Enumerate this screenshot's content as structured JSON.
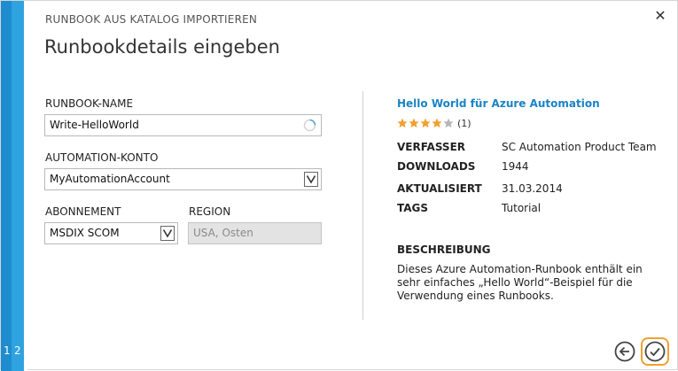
{
  "wizard": {
    "subtitle": "RUNBOOK AUS KATALOG IMPORTIEREN",
    "title": "Runbookdetails eingeben",
    "steps": [
      "1",
      "2"
    ],
    "current_step": 2
  },
  "form": {
    "runbook_name": {
      "label": "RUNBOOK-NAME",
      "value": "Write-HelloWorld"
    },
    "automation_account": {
      "label": "AUTOMATION-KONTO",
      "value": "MyAutomationAccount"
    },
    "subscription": {
      "label": "ABONNEMENT",
      "value": "MSDIX SCOM"
    },
    "region": {
      "label": "REGION",
      "value": "USA, Osten"
    }
  },
  "details": {
    "title": "Hello World für Azure Automation",
    "rating": {
      "stars": 4,
      "max": 5,
      "count_text": "(1)"
    },
    "meta": [
      {
        "key": "VERFASSER",
        "value": "SC Automation Product Team"
      },
      {
        "key": "DOWNLOADS",
        "value": "1944"
      },
      {
        "key": "AKTUALISIERT",
        "value": "31.03.2014"
      },
      {
        "key": "TAGS",
        "value": "Tutorial"
      }
    ],
    "description_title": "BESCHREIBUNG",
    "description": "Dieses Azure Automation-Runbook enthält ein sehr einfaches „Hello World“-Beispiel für die Verwendung eines Runbooks."
  },
  "colors": {
    "accent": "#1a83c5",
    "rail_dark": "#1e8dd0",
    "rail_light": "#2fa3e0",
    "star": "#f0a030",
    "highlight_border": "#f0a030"
  },
  "icons": {
    "close": "close-icon",
    "loading": "loading-spinner-icon",
    "dropdown": "dropdown-arrow-icon",
    "back": "back-arrow-icon",
    "finish": "checkmark-icon"
  }
}
